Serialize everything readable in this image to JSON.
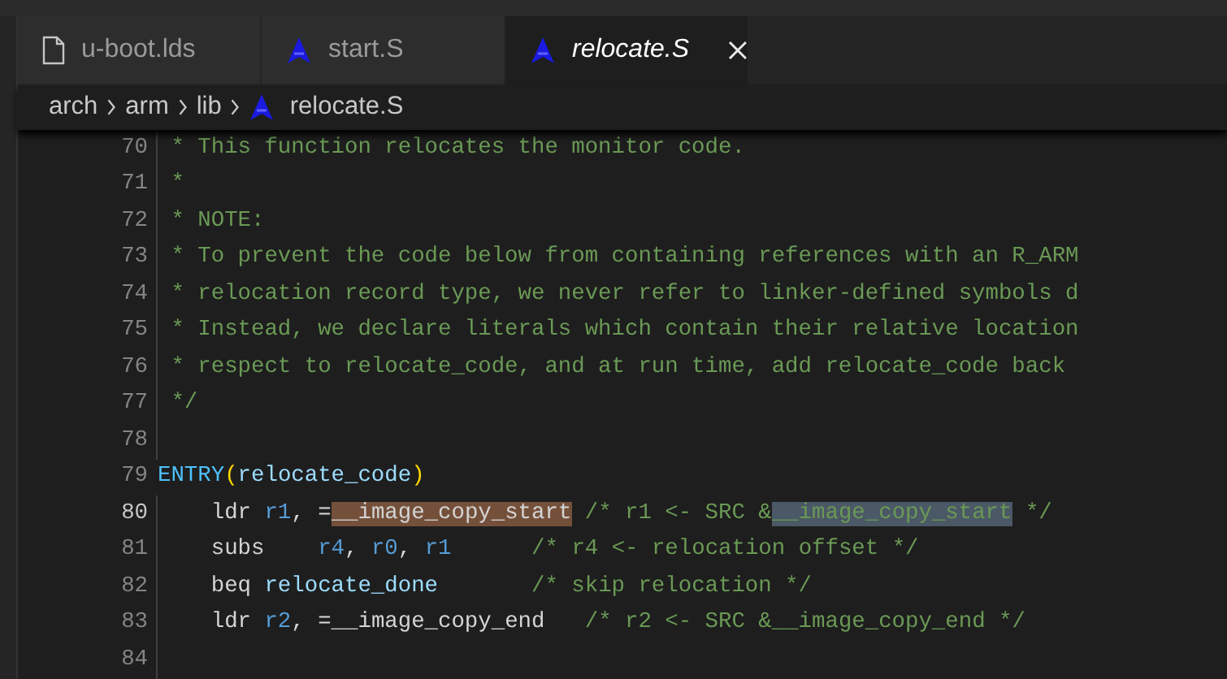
{
  "tabs": [
    {
      "label": "u-boot.lds",
      "kind": "plain",
      "selected": false
    },
    {
      "label": "start.S",
      "kind": "assembly",
      "selected": false
    },
    {
      "label": "relocate.S",
      "kind": "assembly",
      "selected": true
    }
  ],
  "breadcrumb": [
    {
      "label": "arch",
      "kind": "folder"
    },
    {
      "label": "arm",
      "kind": "folder"
    },
    {
      "label": "lib",
      "kind": "folder"
    },
    {
      "label": "relocate.S",
      "kind": "assembly"
    }
  ],
  "lines": [
    {
      "number": "70",
      "current": false,
      "tokens": [
        {
          "text": " * This function relocates the monitor code.",
          "kind": "comment"
        }
      ]
    },
    {
      "number": "71",
      "current": false,
      "tokens": [
        {
          "text": " *",
          "kind": "comment"
        }
      ]
    },
    {
      "number": "72",
      "current": false,
      "tokens": [
        {
          "text": " * NOTE:",
          "kind": "comment"
        }
      ]
    },
    {
      "number": "73",
      "current": false,
      "tokens": [
        {
          "text": " * To prevent the code below from containing references with an R_ARM",
          "kind": "comment"
        }
      ]
    },
    {
      "number": "74",
      "current": false,
      "tokens": [
        {
          "text": " * relocation record type, we never refer to linker-defined symbols d",
          "kind": "comment"
        }
      ]
    },
    {
      "number": "75",
      "current": false,
      "tokens": [
        {
          "text": " * Instead, we declare literals which contain their relative location",
          "kind": "comment"
        }
      ]
    },
    {
      "number": "76",
      "current": false,
      "tokens": [
        {
          "text": " * respect to relocate_code, and at run time, add relocate_code back",
          "kind": "comment"
        }
      ]
    },
    {
      "number": "77",
      "current": false,
      "tokens": [
        {
          "text": " */",
          "kind": "comment"
        }
      ]
    },
    {
      "number": "78",
      "current": false
    },
    {
      "number": "79",
      "current": false,
      "tokens": [
        {
          "text": "ENTRY",
          "kind": "macro"
        },
        {
          "text": "(",
          "kind": "paren"
        },
        {
          "text": "relocate_code",
          "kind": "ident"
        },
        {
          "text": ")",
          "kind": "paren"
        }
      ]
    },
    {
      "number": "80",
      "current": true,
      "tokens": [
        {
          "text": "    ldr ",
          "kind": "plain"
        },
        {
          "text": "r1",
          "kind": "register"
        },
        {
          "text": ", =",
          "kind": "plain"
        },
        {
          "text": "__image_copy_start",
          "kind": "selection"
        },
        {
          "text": " /* r1 <- SRC &",
          "kind": "comment"
        },
        {
          "text": "__image_copy_start",
          "kind": "match"
        },
        {
          "text": " */",
          "kind": "comment"
        }
      ]
    },
    {
      "number": "81",
      "current": false,
      "tokens": [
        {
          "text": "    subs    ",
          "kind": "plain"
        },
        {
          "text": "r4",
          "kind": "register"
        },
        {
          "text": ", ",
          "kind": "plain"
        },
        {
          "text": "r0",
          "kind": "register"
        },
        {
          "text": ", ",
          "kind": "plain"
        },
        {
          "text": "r1",
          "kind": "register"
        },
        {
          "text": "      /* r4 <- relocation offset */",
          "kind": "comment"
        }
      ]
    },
    {
      "number": "82",
      "current": false,
      "tokens": [
        {
          "text": "    beq ",
          "kind": "plain"
        },
        {
          "text": "relocate_done",
          "kind": "ident"
        },
        {
          "text": "       /* skip relocation */",
          "kind": "comment"
        }
      ]
    },
    {
      "number": "83",
      "current": false,
      "tokens": [
        {
          "text": "    ldr ",
          "kind": "plain"
        },
        {
          "text": "r2",
          "kind": "register"
        },
        {
          "text": ", =__image_copy_end",
          "kind": "plain"
        },
        {
          "text": "   /* r2 <- SRC &__image_copy_end */",
          "kind": "comment"
        }
      ]
    },
    {
      "number": "84",
      "current": false
    }
  ]
}
